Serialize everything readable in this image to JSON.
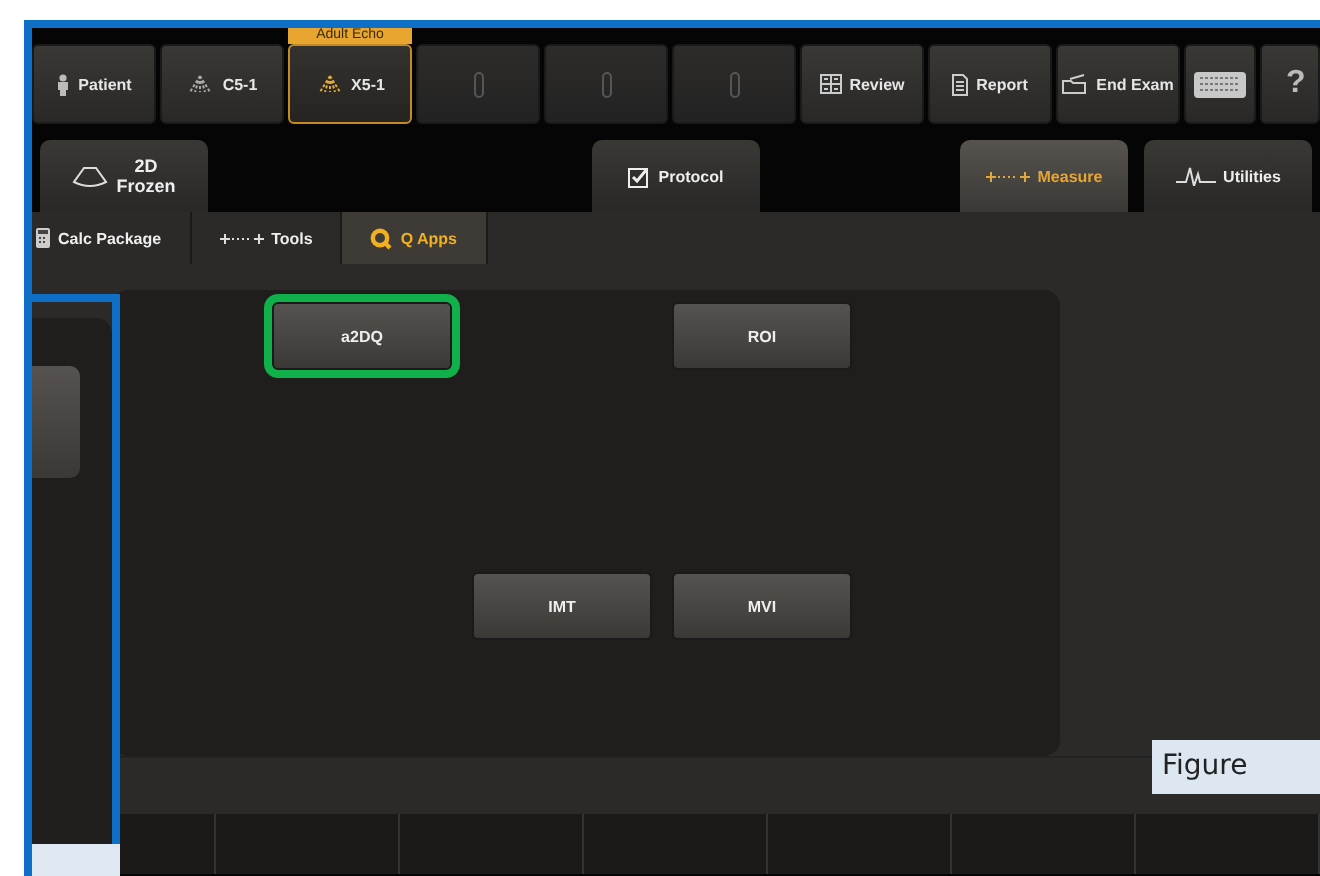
{
  "preset_label": "Adult Echo",
  "top_buttons": [
    {
      "kind": "patient",
      "label": "Patient",
      "selected": false
    },
    {
      "kind": "probe",
      "label": "C5-1",
      "selected": false
    },
    {
      "kind": "probe",
      "label": "X5-1",
      "selected": true
    },
    {
      "kind": "empty",
      "selected": false
    },
    {
      "kind": "empty",
      "selected": false
    },
    {
      "kind": "empty",
      "selected": false
    },
    {
      "kind": "review",
      "label": "Review",
      "selected": false
    },
    {
      "kind": "report",
      "label": "Report",
      "selected": false
    },
    {
      "kind": "end",
      "label": "End Exam",
      "selected": false
    },
    {
      "kind": "keyboard",
      "selected": false
    },
    {
      "kind": "help",
      "label": "?",
      "selected": false
    }
  ],
  "mode_tabs": [
    {
      "kind": "frozen",
      "label": "2D Frozen",
      "selected": false
    },
    {
      "kind": "protocol",
      "label": "Protocol",
      "selected": false
    },
    {
      "kind": "measure",
      "label": "Measure",
      "selected": true
    },
    {
      "kind": "utilities",
      "label": "Utilities",
      "selected": false
    }
  ],
  "sub_tabs": [
    {
      "kind": "calc",
      "label": "Calc Package",
      "selected": false
    },
    {
      "kind": "tools",
      "label": "Tools",
      "selected": false
    },
    {
      "kind": "qapps",
      "label": "Q Apps",
      "selected": true
    }
  ],
  "apps": [
    {
      "label": "a2DQ",
      "highlighted": true
    },
    {
      "label": "ROI",
      "highlighted": false
    },
    {
      "label": "IMT",
      "highlighted": false
    },
    {
      "label": "MVI",
      "highlighted": false
    }
  ],
  "figure_caption": "Figure"
}
